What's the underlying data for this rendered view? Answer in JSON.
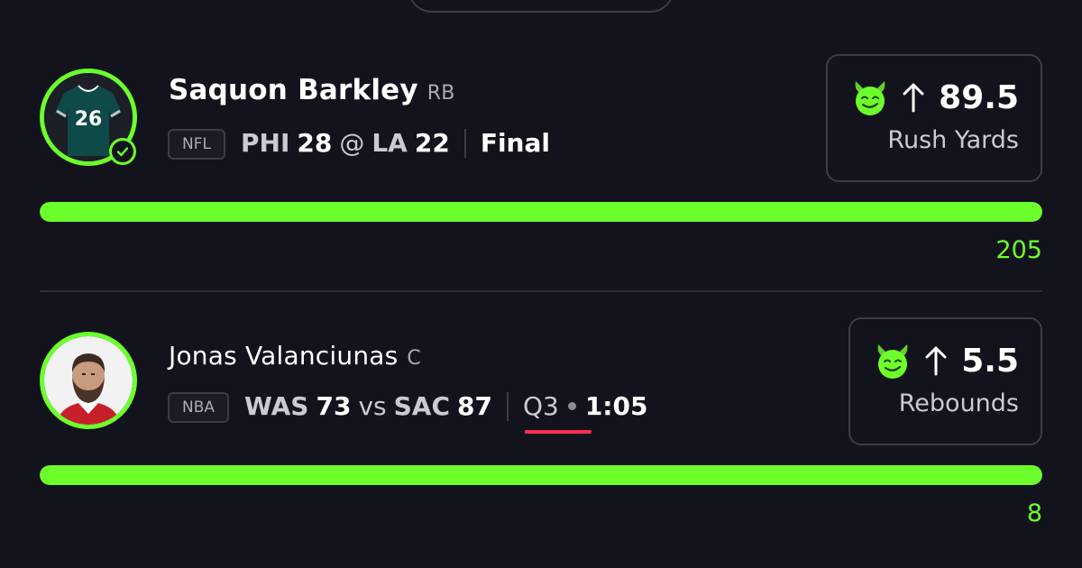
{
  "picks": [
    {
      "player": "Saquon Barkley",
      "position": "RB",
      "league": "NFL",
      "away_team": "PHI",
      "away_score": "28",
      "separator": "@",
      "home_team": "LA",
      "home_score": "22",
      "status": "Final",
      "direction_icon": "arrow-up-icon",
      "line": "89.5",
      "stat": "Rush Yards",
      "actual": "205",
      "progress": 1.0,
      "avatar_icon": "jersey-icon",
      "jersey_number": "26",
      "completed_icon": "check-icon"
    },
    {
      "player": "Jonas Valanciunas",
      "position": "C",
      "league": "NBA",
      "away_team": "WAS",
      "away_score": "73",
      "separator": "vs",
      "home_team": "SAC",
      "home_score": "87",
      "period": "Q3",
      "clock": "1:05",
      "direction_icon": "arrow-up-icon",
      "line": "5.5",
      "stat": "Rebounds",
      "actual": "8",
      "progress": 1.0,
      "avatar_icon": "player-headshot"
    }
  ],
  "colors": {
    "accent_green": "#6cff2b",
    "live_red": "#ff2f50",
    "background": "#12131c"
  }
}
